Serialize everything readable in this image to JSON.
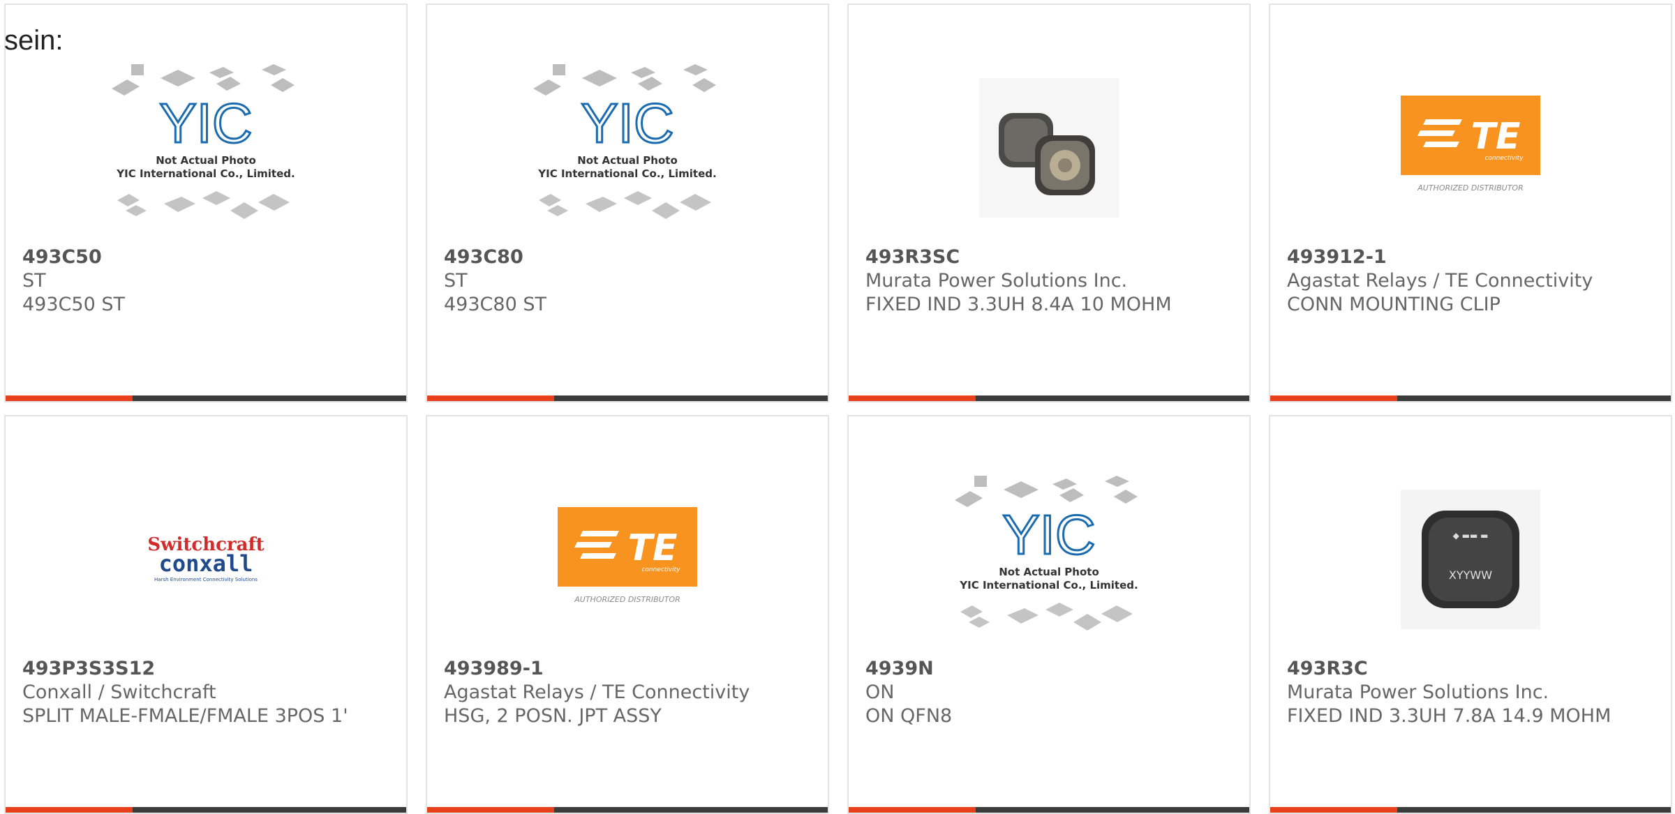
{
  "lead_text": "sein:",
  "colors": {
    "accent": "#e8401a",
    "bar": "#3b3b3b",
    "border": "#e3e3e3",
    "te_orange": "#f7931e"
  },
  "yic_placeholder": {
    "logo_text": "YIC",
    "line1": "Not Actual Photo",
    "line2": "YIC International Co., Limited."
  },
  "te_logo": {
    "mark": "TE",
    "sub": "connectivity",
    "authorized": "AUTHORIZED DISTRIBUTOR"
  },
  "conxall_logo": {
    "line1": "Switchcraft",
    "line2": "conxall",
    "tag": "Harsh Environment Connectivity Solutions"
  },
  "inductor_marking": "XYYWW",
  "products": [
    {
      "part": "493C50",
      "manufacturer": "ST",
      "description": "493C50 ST",
      "image": "yic-placeholder"
    },
    {
      "part": "493C80",
      "manufacturer": "ST",
      "description": "493C80 ST",
      "image": "yic-placeholder"
    },
    {
      "part": "493R3SC",
      "manufacturer": "Murata Power Solutions Inc.",
      "description": "FIXED IND 3.3UH 8.4A 10 MOHM",
      "image": "inductor-pair"
    },
    {
      "part": "493912-1",
      "manufacturer": "Agastat Relays / TE Connectivity",
      "description": "CONN MOUNTING CLIP",
      "image": "te-logo"
    },
    {
      "part": "493P3S3S12",
      "manufacturer": "Conxall / Switchcraft",
      "description": "SPLIT MALE-FMALE/FMALE 3POS 1'",
      "image": "conxall-logo"
    },
    {
      "part": "493989-1",
      "manufacturer": "Agastat Relays / TE Connectivity",
      "description": "HSG, 2 POSN. JPT ASSY",
      "image": "te-logo"
    },
    {
      "part": "4939N",
      "manufacturer": "ON",
      "description": "ON QFN8",
      "image": "yic-placeholder"
    },
    {
      "part": "493R3C",
      "manufacturer": "Murata Power Solutions Inc.",
      "description": "FIXED IND 3.3UH 7.8A 14.9 MOHM",
      "image": "inductor-single"
    }
  ]
}
